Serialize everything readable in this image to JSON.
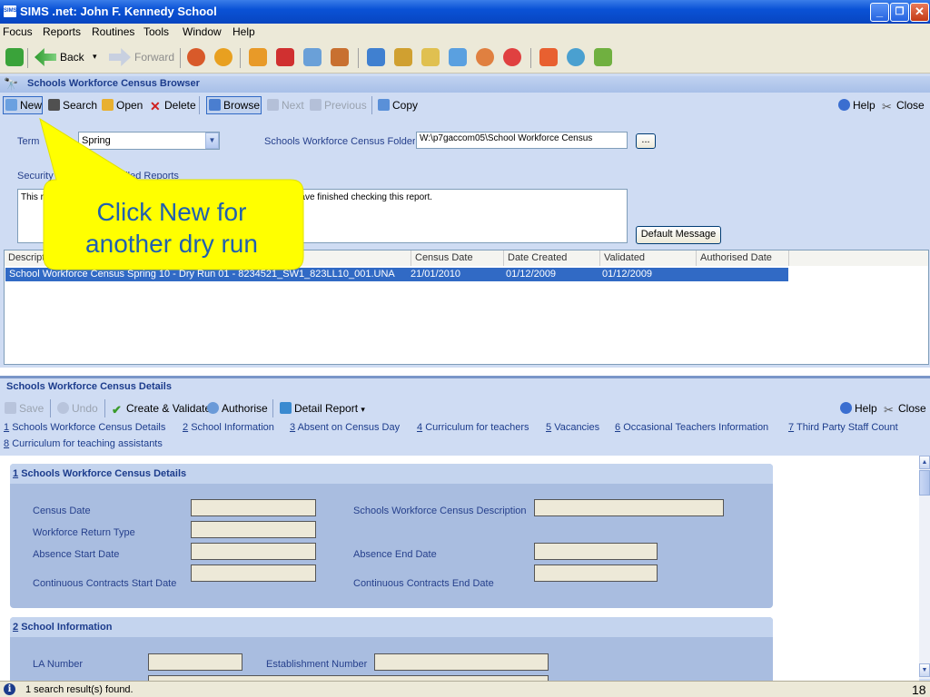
{
  "window": {
    "app_icon_text": "SIMS",
    "title": "SIMS .net: John F. Kennedy School",
    "minimize": "_",
    "restore": "❐",
    "close": "✕"
  },
  "menu": [
    "Focus",
    "Reports",
    "Routines",
    "Tools",
    "Window",
    "Help"
  ],
  "toolbar": {
    "back": "Back",
    "back_dropdown": "▾",
    "forward": "Forward"
  },
  "browser": {
    "title": "Schools Workforce Census Browser",
    "buttons": {
      "new": "New",
      "search": "Search",
      "open": "Open",
      "delete": "Delete",
      "browse": "Browse",
      "next": "Next",
      "previous": "Previous",
      "copy": "Copy",
      "help": "Help",
      "close": "Close"
    },
    "term_label": "Term",
    "term_value": "Spring",
    "folder_label": "Schools Workforce Census Folder",
    "folder_value": "W:\\p7gaccom05\\School Workforce Census",
    "folder_browse": "...",
    "security_label": "Security message for Failed Reports",
    "security_text": "This report will be sent to LA. Please send it to Mr Bloggs when you have finished checking this report.",
    "default_message": "Default Message",
    "grid": {
      "headers": [
        "Description",
        "Census Date",
        "Date Created",
        "Validated",
        "Authorised Date"
      ],
      "rows": [
        {
          "description": "School Workforce Census Spring 10 - Dry Run 01 - 8234521_SW1_823LL10_001.UNA",
          "census_date": "21/01/2010",
          "date_created": "01/12/2009",
          "validated": "01/12/2009",
          "authorised": ""
        }
      ]
    }
  },
  "callout": {
    "line1": "Click New for",
    "line2": "another dry run"
  },
  "details": {
    "title": "Schools Workforce Census Details",
    "buttons": {
      "save": "Save",
      "undo": "Undo",
      "create_validate": "Create & Validate",
      "authorise": "Authorise",
      "detail_report": "Detail Report",
      "detail_report_dropdown": "▾",
      "help": "Help",
      "close": "Close"
    },
    "links": [
      {
        "num": "1",
        "text": "Schools Workforce Census Details"
      },
      {
        "num": "2",
        "text": "School Information"
      },
      {
        "num": "3",
        "text": "Absent on Census Day"
      },
      {
        "num": "4",
        "text": "Curriculum for teachers"
      },
      {
        "num": "5",
        "text": "Vacancies"
      },
      {
        "num": "6",
        "text": "Occasional Teachers Information"
      },
      {
        "num": "7",
        "text": "Third Party Staff Count"
      },
      {
        "num": "8",
        "text": "Curriculum for teaching assistants"
      }
    ],
    "section1": {
      "num": "1",
      "title": "Schools Workforce Census Details",
      "census_date": "Census Date",
      "return_type": "Workforce Return Type",
      "absence_start": "Absence Start Date",
      "continuous_start": "Continuous Contracts Start Date",
      "census_description": "Schools Workforce Census Description",
      "absence_end": "Absence End Date",
      "continuous_end": "Continuous Contracts End Date"
    },
    "section2": {
      "num": "2",
      "title": "School Information",
      "la_number": "LA Number",
      "establishment_number": "Establishment Number"
    }
  },
  "status": {
    "text": "1 search result(s) found.",
    "page_number": "18"
  },
  "colors": {
    "title_bar": "#0a52d6",
    "panel": "#cfdcf3",
    "selection": "#316ac5",
    "callout": "#ffff00",
    "callout_text": "#2060b0"
  }
}
